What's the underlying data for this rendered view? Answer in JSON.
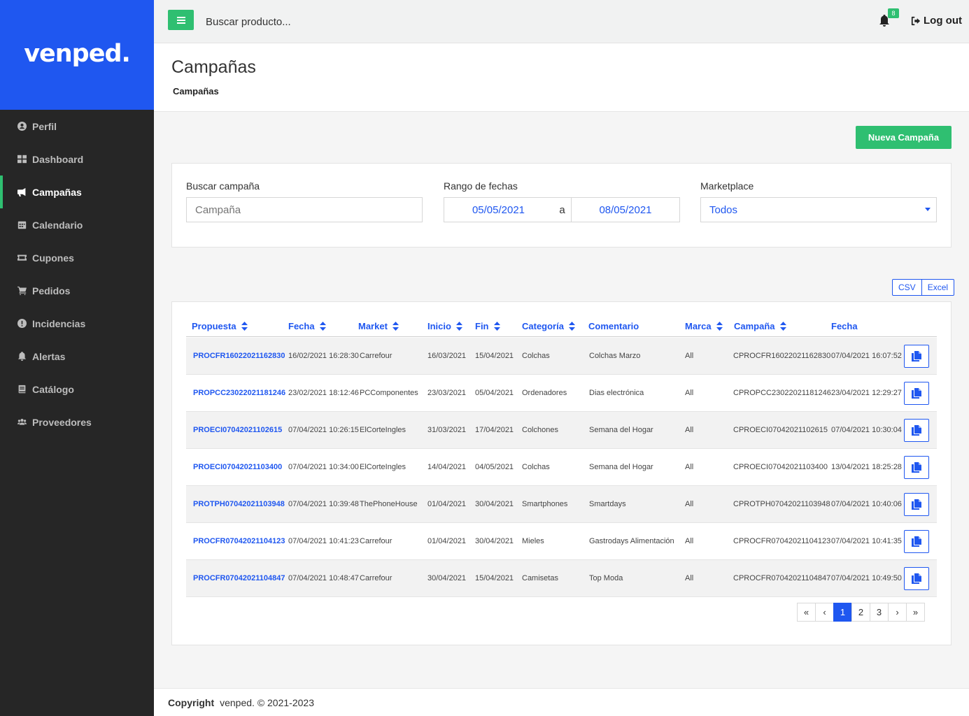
{
  "brand": {
    "name": "venped."
  },
  "sidebar": {
    "items": [
      {
        "label": "Perfil",
        "icon": "user-circle-icon"
      },
      {
        "label": "Dashboard",
        "icon": "grid-icon"
      },
      {
        "label": "Campañas",
        "icon": "bullhorn-icon",
        "active": true
      },
      {
        "label": "Calendario",
        "icon": "calendar-icon"
      },
      {
        "label": "Cupones",
        "icon": "ticket-icon"
      },
      {
        "label": "Pedidos",
        "icon": "cart-icon"
      },
      {
        "label": "Incidencias",
        "icon": "exclamation-circle-icon"
      },
      {
        "label": "Alertas",
        "icon": "bell-icon"
      },
      {
        "label": "Catálogo",
        "icon": "book-icon"
      },
      {
        "label": "Proveedores",
        "icon": "users-icon"
      }
    ]
  },
  "topbar": {
    "search_placeholder": "Buscar producto...",
    "notification_count": "8",
    "logout_label": "Log out"
  },
  "header": {
    "title": "Campañas",
    "breadcrumb": "Campañas"
  },
  "actions": {
    "new_campaign_label": "Nueva Campaña"
  },
  "filters": {
    "search_label": "Buscar campaña",
    "search_placeholder": "Campaña",
    "date_label": "Rango de fechas",
    "date_from": "05/05/2021",
    "date_separator": "a",
    "date_to": "08/05/2021",
    "marketplace_label": "Marketplace",
    "marketplace_value": "Todos"
  },
  "export": {
    "csv_label": "CSV",
    "excel_label": "Excel"
  },
  "table": {
    "headers": [
      {
        "label": "Propuesta",
        "sortable": true
      },
      {
        "label": "Fecha",
        "sortable": true
      },
      {
        "label": "Market",
        "sortable": true
      },
      {
        "label": "Inicio",
        "sortable": true
      },
      {
        "label": "Fin",
        "sortable": true
      },
      {
        "label": "Categoría",
        "sortable": true
      },
      {
        "label": "Comentario",
        "sortable": false
      },
      {
        "label": "Marca",
        "sortable": true
      },
      {
        "label": "Campaña",
        "sortable": true
      },
      {
        "label": "Fecha",
        "sortable": false
      }
    ],
    "rows": [
      [
        "PROCFR16022021162830",
        "16/02/2021 16:28:30",
        "Carrefour",
        "16/03/2021",
        "15/04/2021",
        "Colchas",
        "Colchas Marzo",
        "All",
        "CPROCFR16022021162830",
        "07/04/2021 16:07:52"
      ],
      [
        "PROPCC23022021181246",
        "23/02/2021 18:12:46",
        "PCComponentes",
        "23/03/2021",
        "05/04/2021",
        "Ordenadores",
        "Dias electrónica",
        "All",
        "CPROPCC23022021181246",
        "23/04/2021 12:29:27"
      ],
      [
        "PROECI07042021102615",
        "07/04/2021 10:26:15",
        "ElCorteIngles",
        "31/03/2021",
        "17/04/2021",
        "Colchones",
        "Semana del Hogar",
        "All",
        "CPROECI07042021102615",
        "07/04/2021 10:30:04"
      ],
      [
        "PROECI07042021103400",
        "07/04/2021 10:34:00",
        "ElCorteIngles",
        "14/04/2021",
        "04/05/2021",
        "Colchas",
        "Semana del Hogar",
        "All",
        "CPROECI07042021103400",
        "13/04/2021 18:25:28"
      ],
      [
        "PROTPH07042021103948",
        "07/04/2021 10:39:48",
        "ThePhoneHouse",
        "01/04/2021",
        "30/04/2021",
        "Smartphones",
        "Smartdays",
        "All",
        "CPROTPH07042021103948",
        "07/04/2021 10:40:06"
      ],
      [
        "PROCFR07042021104123",
        "07/04/2021 10:41:23",
        "Carrefour",
        "01/04/2021",
        "30/04/2021",
        "Mieles",
        "Gastrodays Alimentación",
        "All",
        "CPROCFR07042021104123",
        "07/04/2021 10:41:35"
      ],
      [
        "PROCFR07042021104847",
        "07/04/2021 10:48:47",
        "Carrefour",
        "30/04/2021",
        "15/04/2021",
        "Camisetas",
        "Top Moda",
        "All",
        "CPROCFR07042021104847",
        "07/04/2021 10:49:50"
      ]
    ]
  },
  "pagination": {
    "first": "«",
    "prev": "‹",
    "pages": [
      "1",
      "2",
      "3"
    ],
    "current": "1",
    "next": "›",
    "last": "»"
  },
  "footer": {
    "copyright_label": "Copyright",
    "text": "venped. © 2021-2023"
  },
  "colors": {
    "brand_blue": "#1f57f0",
    "accent_green": "#2fbf71",
    "sidebar_bg": "#262626"
  }
}
